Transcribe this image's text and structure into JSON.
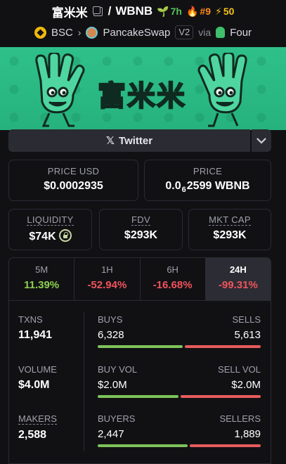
{
  "header": {
    "token_name": "富米米",
    "separator": "/",
    "quote": "WBNB",
    "age": "7h",
    "rank": "#9",
    "boosts": "50",
    "chain": "BSC",
    "dex": "PancakeSwap",
    "version": "V2",
    "via_label": "via",
    "launchpad": "Four"
  },
  "banner": {
    "title": "富米米"
  },
  "social": {
    "twitter_label": "Twitter"
  },
  "price_usd": {
    "label": "PRICE USD",
    "value": "$0.0002935"
  },
  "price_native": {
    "label": "PRICE",
    "prefix": "0.0",
    "zeros": "6",
    "digits": "2599",
    "unit": "WBNB"
  },
  "liquidity": {
    "label": "LIQUIDITY",
    "value": "$74K"
  },
  "fdv": {
    "label": "FDV",
    "value": "$293K"
  },
  "mkt_cap": {
    "label": "MKT CAP",
    "value": "$293K"
  },
  "timeframes": [
    {
      "label": "5M",
      "change": "11.39%"
    },
    {
      "label": "1H",
      "change": "-52.94%"
    },
    {
      "label": "6H",
      "change": "-16.68%"
    },
    {
      "label": "24H",
      "change": "-99.31%"
    }
  ],
  "stats": {
    "txns": {
      "label": "TXNS",
      "value": "11,941"
    },
    "volume": {
      "label": "VOLUME",
      "value": "$4.0M"
    },
    "makers": {
      "label": "MAKERS",
      "value": "2,588"
    },
    "buys": {
      "label": "BUYS",
      "value": "6,328",
      "ratio": 0.53
    },
    "sells": {
      "label": "SELLS",
      "value": "5,613"
    },
    "buy_vol": {
      "label": "BUY VOL",
      "value": "$2.0M",
      "ratio": 0.5
    },
    "sell_vol": {
      "label": "SELL VOL",
      "value": "$2.0M"
    },
    "buyers": {
      "label": "BUYERS",
      "value": "2,447",
      "ratio": 0.56
    },
    "sellers": {
      "label": "SELLERS",
      "value": "1,889"
    }
  },
  "colors": {
    "positive": "#8fd14f",
    "negative": "#f0535b",
    "banner": "#2fc08a"
  }
}
